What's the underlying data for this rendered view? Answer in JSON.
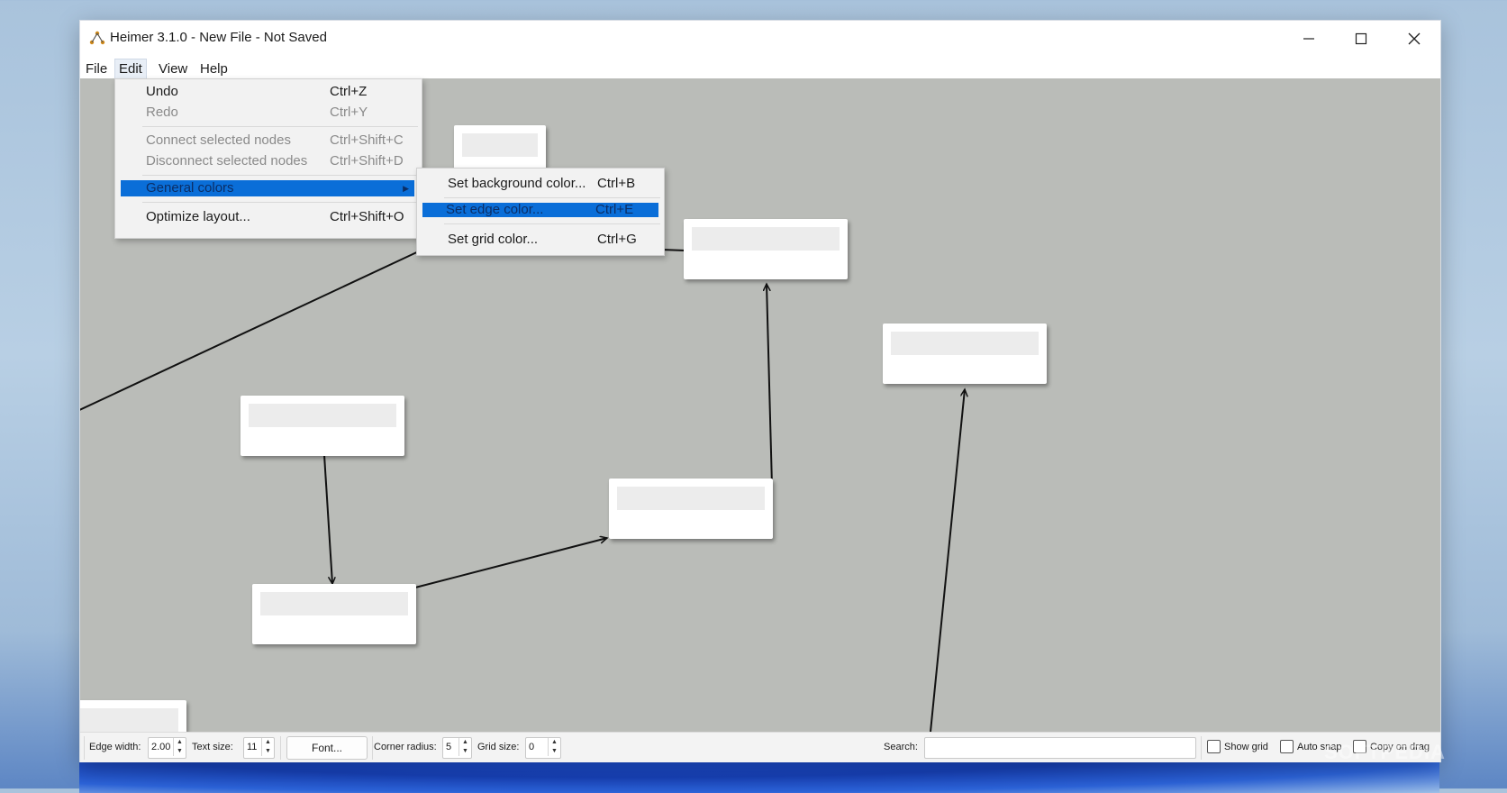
{
  "window": {
    "title": "Heimer 3.1.0 - New File - Not Saved"
  },
  "menubar": {
    "items": [
      "File",
      "Edit",
      "View",
      "Help"
    ]
  },
  "edit_menu": {
    "items": [
      {
        "label": "Undo",
        "shortcut": "Ctrl+Z",
        "enabled": true
      },
      {
        "label": "Redo",
        "shortcut": "Ctrl+Y",
        "enabled": false
      },
      {
        "label": "Connect selected nodes",
        "shortcut": "Ctrl+Shift+C",
        "enabled": false
      },
      {
        "label": "Disconnect selected nodes",
        "shortcut": "Ctrl+Shift+D",
        "enabled": false
      },
      {
        "label": "General colors",
        "shortcut": "",
        "enabled": true,
        "highlighted": true
      },
      {
        "label": "Optimize layout...",
        "shortcut": "Ctrl+Shift+O",
        "enabled": true
      }
    ]
  },
  "colors_submenu": {
    "items": [
      {
        "label": "Set background color...",
        "shortcut": "Ctrl+B"
      },
      {
        "label": "Set edge color...",
        "shortcut": "Ctrl+E",
        "highlighted": true
      },
      {
        "label": "Set grid color...",
        "shortcut": "Ctrl+G"
      }
    ]
  },
  "toolbar": {
    "edge_width_label": "Edge width:",
    "edge_width": "2.00",
    "text_size_label": "Text size:",
    "text_size": "11",
    "font_button": "Font...",
    "corner_radius_label": "Corner radius:",
    "corner_radius": "5",
    "grid_size_label": "Grid size:",
    "grid_size": "0",
    "search_label": "Search:",
    "search_value": "",
    "show_grid": "Show grid",
    "auto_snap": "Auto snap",
    "copy_on_drag": "Copy on drag"
  },
  "watermark": "SOFTPEDIA",
  "colors": {
    "canvas": "#babcb8",
    "highlight": "#0a6ed8"
  }
}
